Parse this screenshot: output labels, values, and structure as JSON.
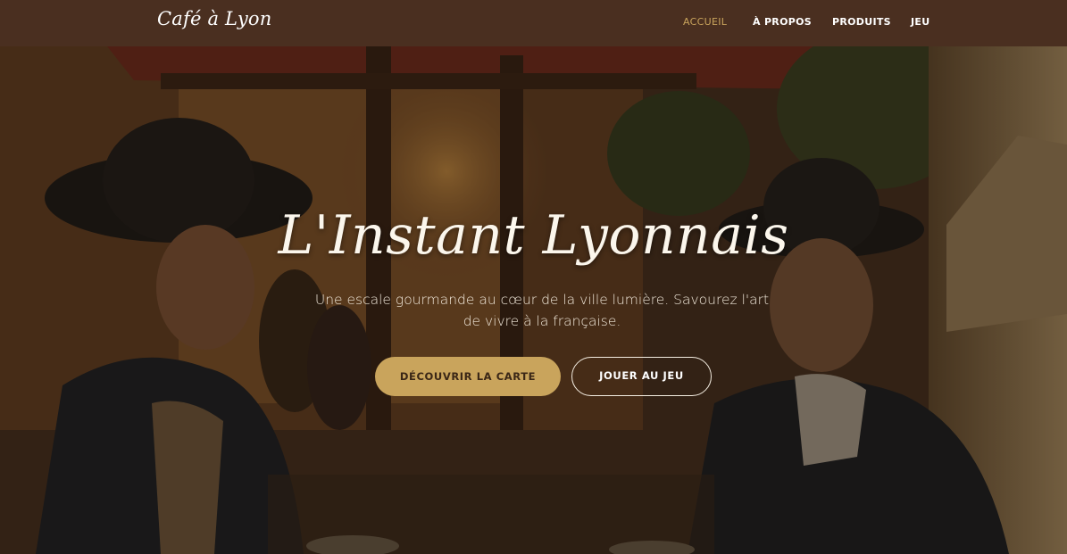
{
  "brand": "Café à Lyon",
  "nav": {
    "items": [
      {
        "label": "ACCUEIL",
        "active": true
      },
      {
        "label": "À PROPOS",
        "active": false
      },
      {
        "label": "PRODUITS",
        "active": false
      },
      {
        "label": "JEU",
        "active": false
      }
    ]
  },
  "hero": {
    "title": "L'Instant Lyonnais",
    "subtitle": "Une escale gourmande au cœur de la ville lumière. Savourez l'art de vivre à la française.",
    "primary_button": "DÉCOUVRIR LA CARTE",
    "secondary_button": "JOUER AU JEU"
  },
  "colors": {
    "navbar": "#4a2f20",
    "accent": "#c9a45c",
    "text_light": "#fbf6ec"
  }
}
